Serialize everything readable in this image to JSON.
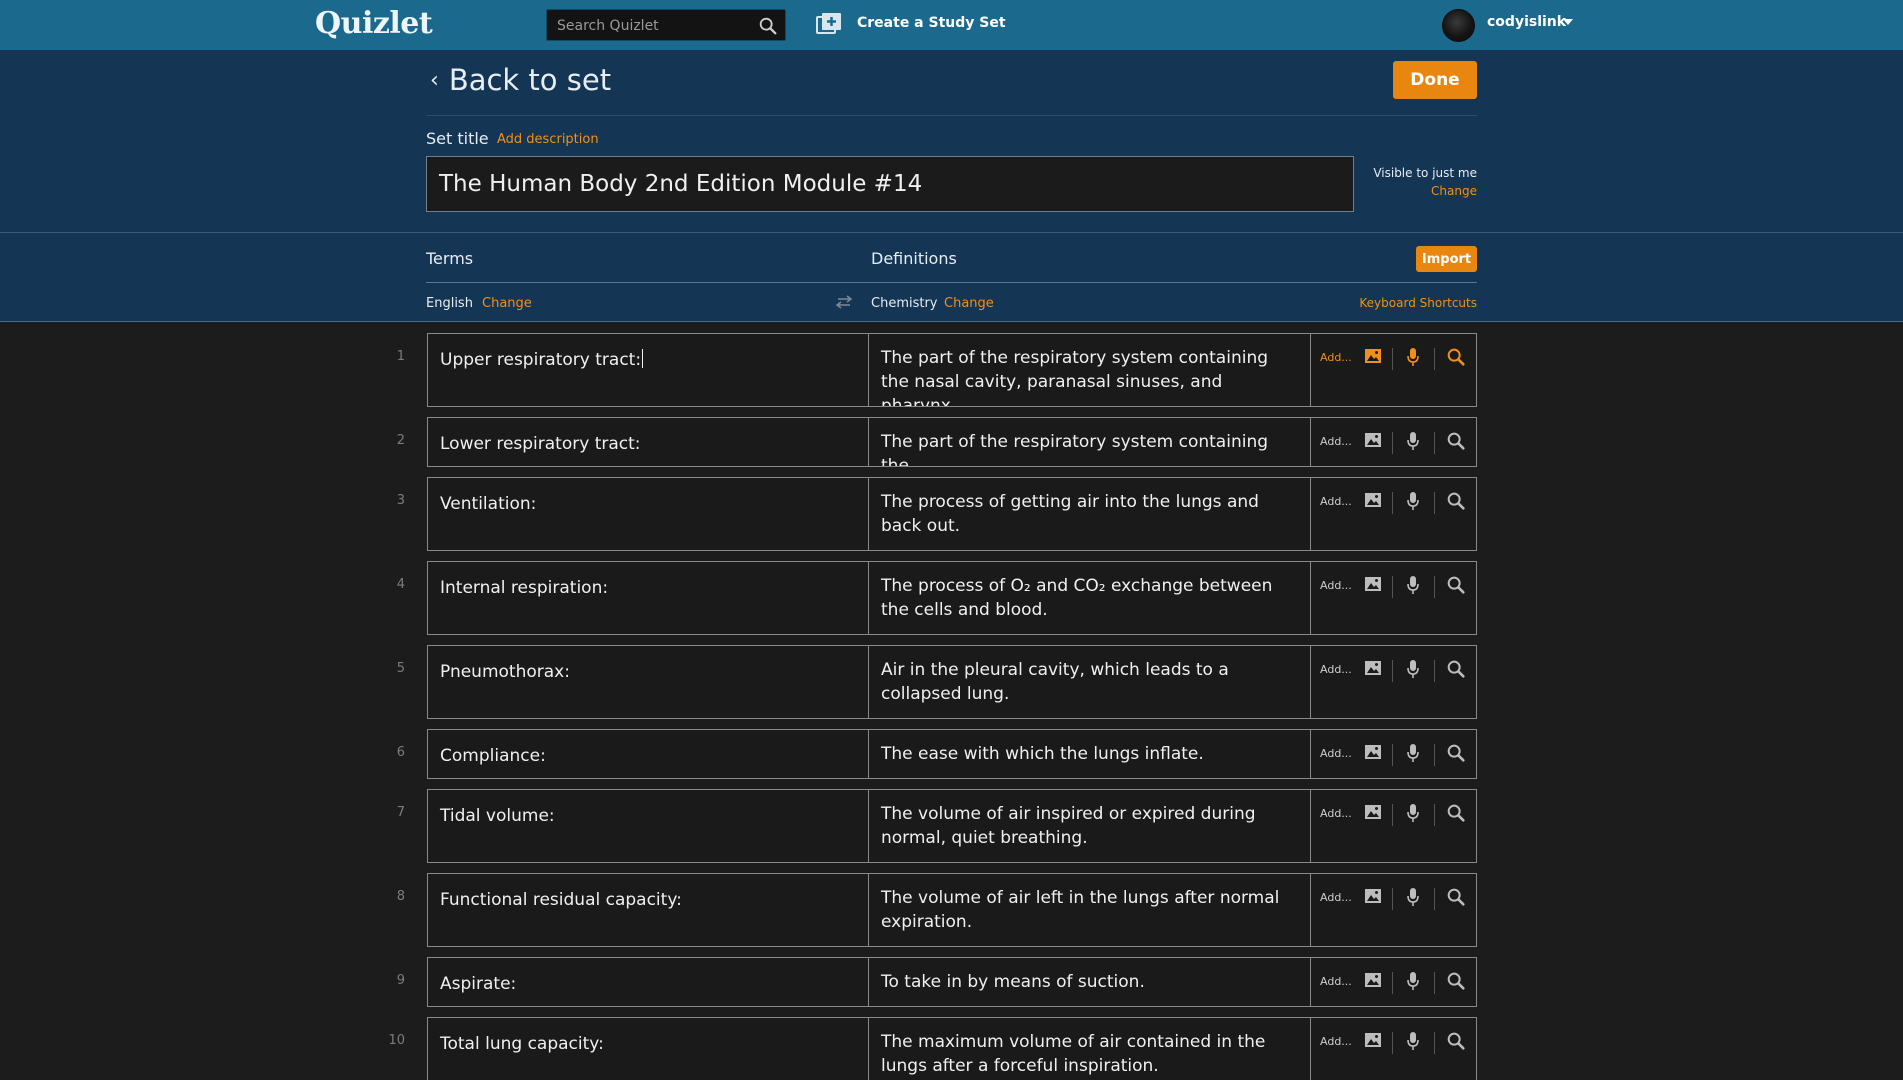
{
  "nav": {
    "logo": "Quizlet",
    "search_placeholder": "Search Quizlet",
    "create_label": "Create a Study Set",
    "username": "codyislink"
  },
  "header": {
    "back_label": "Back to set",
    "done_label": "Done",
    "set_title_label": "Set title",
    "add_description": "Add description",
    "title_value": "The Human Body 2nd Edition Module #14",
    "visibility": "Visible to just me",
    "visibility_change": "Change"
  },
  "columns": {
    "terms": "Terms",
    "definitions": "Definitions",
    "import": "Import",
    "term_language": "English",
    "term_change": "Change",
    "def_language": "Chemistry",
    "def_change": "Change",
    "keyboard_shortcuts": "Keyboard Shortcuts"
  },
  "tools": {
    "add_label": "Add..."
  },
  "cards": [
    {
      "num": "1",
      "term": "Upper respiratory tract:",
      "definition": "The part of the respiratory system containing the nasal cavity, paranasal sinuses, and pharynx."
    },
    {
      "num": "2",
      "term": "Lower respiratory tract:",
      "definition": "The part of the respiratory system containing the"
    },
    {
      "num": "3",
      "term": "Ventilation:",
      "definition": "The process of getting air into the lungs and back out."
    },
    {
      "num": "4",
      "term": "Internal respiration:",
      "definition": "The process of O₂ and CO₂ exchange between the cells and blood."
    },
    {
      "num": "5",
      "term": "Pneumothorax:",
      "definition": "Air in the pleural cavity, which leads to a collapsed lung."
    },
    {
      "num": "6",
      "term": "Compliance:",
      "definition": "The ease with which the lungs inflate."
    },
    {
      "num": "7",
      "term": "Tidal volume:",
      "definition": "The volume of air inspired or expired during normal, quiet breathing."
    },
    {
      "num": "8",
      "term": "Functional residual capacity:",
      "definition": "The volume of air left in the lungs after normal expiration."
    },
    {
      "num": "9",
      "term": "Aspirate:",
      "definition": "To take in by means of suction."
    },
    {
      "num": "10",
      "term": "Total lung capacity:",
      "definition": "The maximum volume of air contained in the lungs after a forceful inspiration."
    }
  ],
  "colors": {
    "nav_bg": "#1b6a8e",
    "header_bg": "#143553",
    "accent": "#e9860f",
    "page_bg": "#1c1c1c"
  }
}
